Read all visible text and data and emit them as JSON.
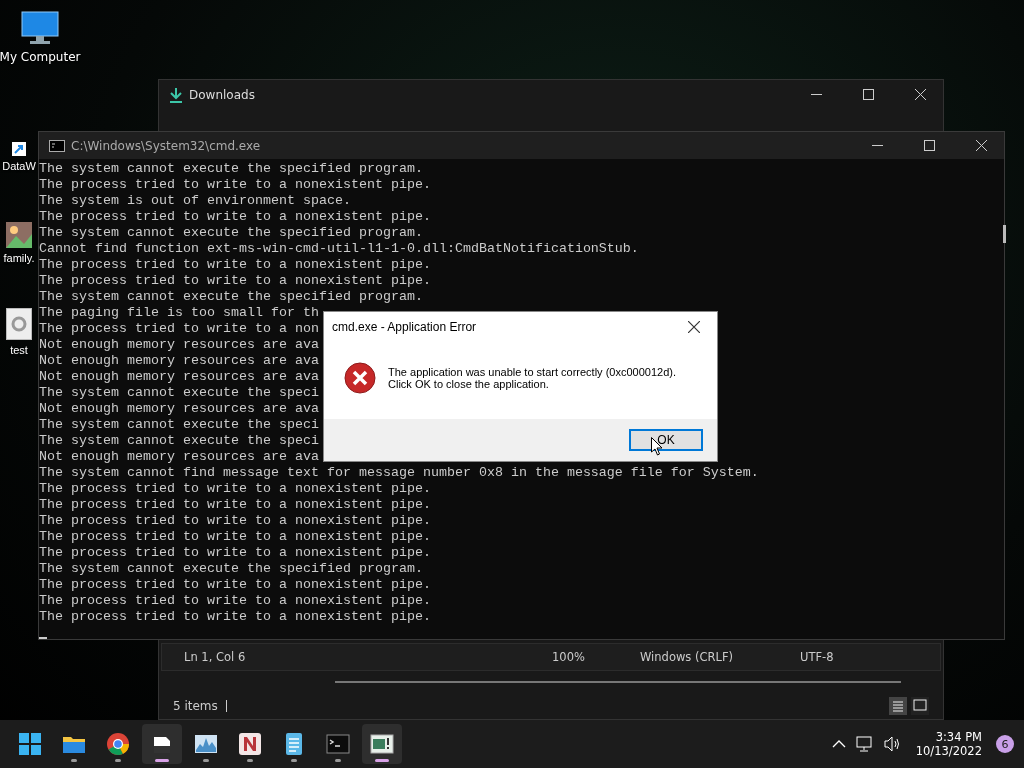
{
  "desktop_icons": [
    {
      "kind": "computer",
      "label": "My Computer"
    },
    {
      "kind": "shortcut",
      "label": "DataW"
    },
    {
      "kind": "image",
      "label": "family."
    },
    {
      "kind": "settings-file",
      "label": "test"
    }
  ],
  "downloads_window": {
    "title": "Downloads",
    "status_bar": [
      "Ln 1, Col 6",
      "100%",
      "Windows (CRLF)",
      "UTF-8"
    ],
    "item_count": "5 items"
  },
  "cmd_window": {
    "title": "C:\\Windows\\System32\\cmd.exe",
    "lines": [
      "The system cannot execute the specified program.",
      "The process tried to write to a nonexistent pipe.",
      "The system is out of environment space.",
      "The process tried to write to a nonexistent pipe.",
      "The system cannot execute the specified program.",
      "Cannot find function ext-ms-win-cmd-util-l1-1-0.dll:CmdBatNotificationStub.",
      "The process tried to write to a nonexistent pipe.",
      "The process tried to write to a nonexistent pipe.",
      "The system cannot execute the specified program.",
      "The paging file is too small for th",
      "The process tried to write to a non",
      "Not enough memory resources are ava",
      "Not enough memory resources are ava",
      "Not enough memory resources are ava",
      "The system cannot execute the speci",
      "Not enough memory resources are ava",
      "The system cannot execute the speci",
      "The system cannot execute the speci",
      "Not enough memory resources are ava",
      "The system cannot find message text for message number 0x8 in the message file for System.",
      "The process tried to write to a nonexistent pipe.",
      "The process tried to write to a nonexistent pipe.",
      "The process tried to write to a nonexistent pipe.",
      "The process tried to write to a nonexistent pipe.",
      "The process tried to write to a nonexistent pipe.",
      "The system cannot execute the specified program.",
      "The process tried to write to a nonexistent pipe.",
      "The process tried to write to a nonexistent pipe.",
      "The process tried to write to a nonexistent pipe."
    ]
  },
  "error_dialog": {
    "title": "cmd.exe - Application Error",
    "message": [
      "The application was unable to start correctly (0xc000012d).",
      "Click OK to close the application."
    ],
    "button": "OK"
  },
  "taskbar": {
    "apps": [
      {
        "kind": "start",
        "running": false,
        "selected": false
      },
      {
        "kind": "folder",
        "running": true,
        "selected": false
      },
      {
        "kind": "browser",
        "running": true,
        "selected": false
      },
      {
        "kind": "files",
        "running": true,
        "selected": true
      },
      {
        "kind": "monitor",
        "running": true,
        "selected": false
      },
      {
        "kind": "n-app",
        "running": true,
        "selected": false
      },
      {
        "kind": "notepad",
        "running": true,
        "selected": false
      },
      {
        "kind": "terminal",
        "running": true,
        "selected": false
      },
      {
        "kind": "error-app",
        "running": true,
        "selected": true
      }
    ],
    "time": "3:34 PM",
    "date": "10/13/2022",
    "notification_count": "6"
  }
}
